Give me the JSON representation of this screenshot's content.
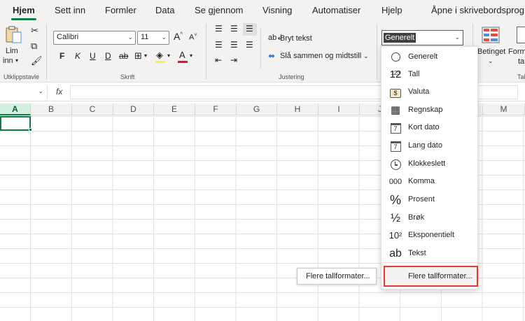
{
  "tabs": [
    "Hjem",
    "Sett inn",
    "Formler",
    "Data",
    "Se gjennom",
    "Visning",
    "Automatiser",
    "Hjelp",
    "Åpne i skrivebordsprog"
  ],
  "clipboard": {
    "paste_label_1": "Lim",
    "paste_label_2": "inn",
    "group_label": "Utklippstavle"
  },
  "font": {
    "name": "Calibri",
    "size": "11",
    "grow": "A",
    "shrink": "A",
    "bold": "F",
    "italic": "K",
    "underline": "U",
    "strike": "D",
    "strikethrough": "ab",
    "group_label": "Skrift"
  },
  "alignment": {
    "wrap_label": "Bryt tekst",
    "merge_label": "Slå sammen og midtstill",
    "group_label": "Justering"
  },
  "number_format": {
    "current": "Generelt"
  },
  "ribbon_right": {
    "conditional_label": "Betinget",
    "format_label_1": "Form",
    "format_label_2": "ta",
    "group_label": "Tal"
  },
  "formula_bar": {
    "fx": "fx"
  },
  "columns": [
    "A",
    "B",
    "C",
    "D",
    "E",
    "F",
    "G",
    "H",
    "I",
    "J",
    "K",
    "L",
    "M"
  ],
  "dropdown": {
    "items": [
      {
        "icon": "123",
        "label": "Generelt"
      },
      {
        "icon": "12",
        "label": "Tall"
      },
      {
        "icon": "$",
        "label": "Valuta"
      },
      {
        "icon": "▦",
        "label": "Regnskap"
      },
      {
        "icon": "7",
        "label": "Kort dato"
      },
      {
        "icon": "7",
        "label": "Lang dato"
      },
      {
        "icon": "",
        "label": "Klokkeslett"
      },
      {
        "icon": "000",
        "label": "Komma"
      },
      {
        "icon": "%",
        "label": "Prosent"
      },
      {
        "icon": "½",
        "label": "Brøk"
      },
      {
        "icon": "10²",
        "label": "Eksponentielt"
      },
      {
        "icon": "ab",
        "label": "Tekst"
      }
    ],
    "more_label": "Flere tallformater...",
    "tooltip": "Flere tallformater..."
  },
  "colors": {
    "accent": "#107c41",
    "highlight_border": "#e03c31"
  }
}
